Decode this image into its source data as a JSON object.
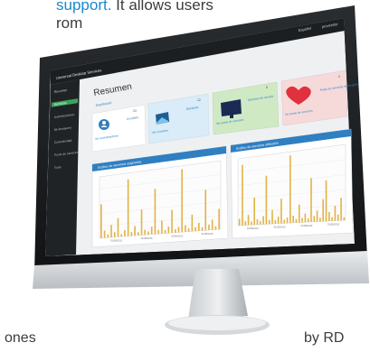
{
  "intro": {
    "line1_link": "support.",
    "line1_rest": " It allows users",
    "line2": "rom"
  },
  "bottom": {
    "left": "ones",
    "right": "by RD"
  },
  "app": {
    "title": "Universal Desktop Services",
    "topbar": {
      "language": "Español",
      "user": "proveedor"
    },
    "sidebar": {
      "items": [
        {
          "label": "Resumen"
        },
        {
          "label": "Servicios"
        },
        {
          "label": "Autenticadores"
        },
        {
          "label": "Mi desayuno"
        },
        {
          "label": "Conectividad"
        },
        {
          "label": "Pools de servicios"
        },
        {
          "label": "Tools"
        }
      ]
    },
    "page_title": "Resumen",
    "breadcrumb": "Dashboard",
    "cards": [
      {
        "count": "23",
        "title": "Usuarios",
        "link": "Ver autenticadores",
        "color": "#ffffff",
        "icon": "user-icon"
      },
      {
        "count": "12",
        "title": "Servicios",
        "link": "Ver servicios",
        "color": "#d9ecf7",
        "icon": "image-icon"
      },
      {
        "count": "8",
        "title": "Servicios de usuario",
        "link": "Ver pools de servicios",
        "color": "#cfe9c5",
        "icon": "monitor-icon"
      },
      {
        "count": "0",
        "title": "Pools de servicios restringidos",
        "link": "Ver pools de servicios",
        "color": "#f6dada",
        "icon": "heart-icon"
      }
    ],
    "charts": [
      {
        "title": "Gráfico de servicios asignados",
        "x_labels": [
          "01/08/2015",
          "01/08/2015",
          "01/08/2015",
          "01/08/2015"
        ]
      },
      {
        "title": "Gráfico de servicios utilizados",
        "x_labels": [
          "01/08/2015",
          "01/08/2015",
          "01/08/2015",
          "01/08/2015"
        ]
      }
    ],
    "colors": {
      "sidebar": "#1f2326",
      "topbar": "#1c1f22",
      "accent": "#2f7fc1",
      "bar": "#e4b246",
      "active_item": "#3aa55a"
    }
  }
}
